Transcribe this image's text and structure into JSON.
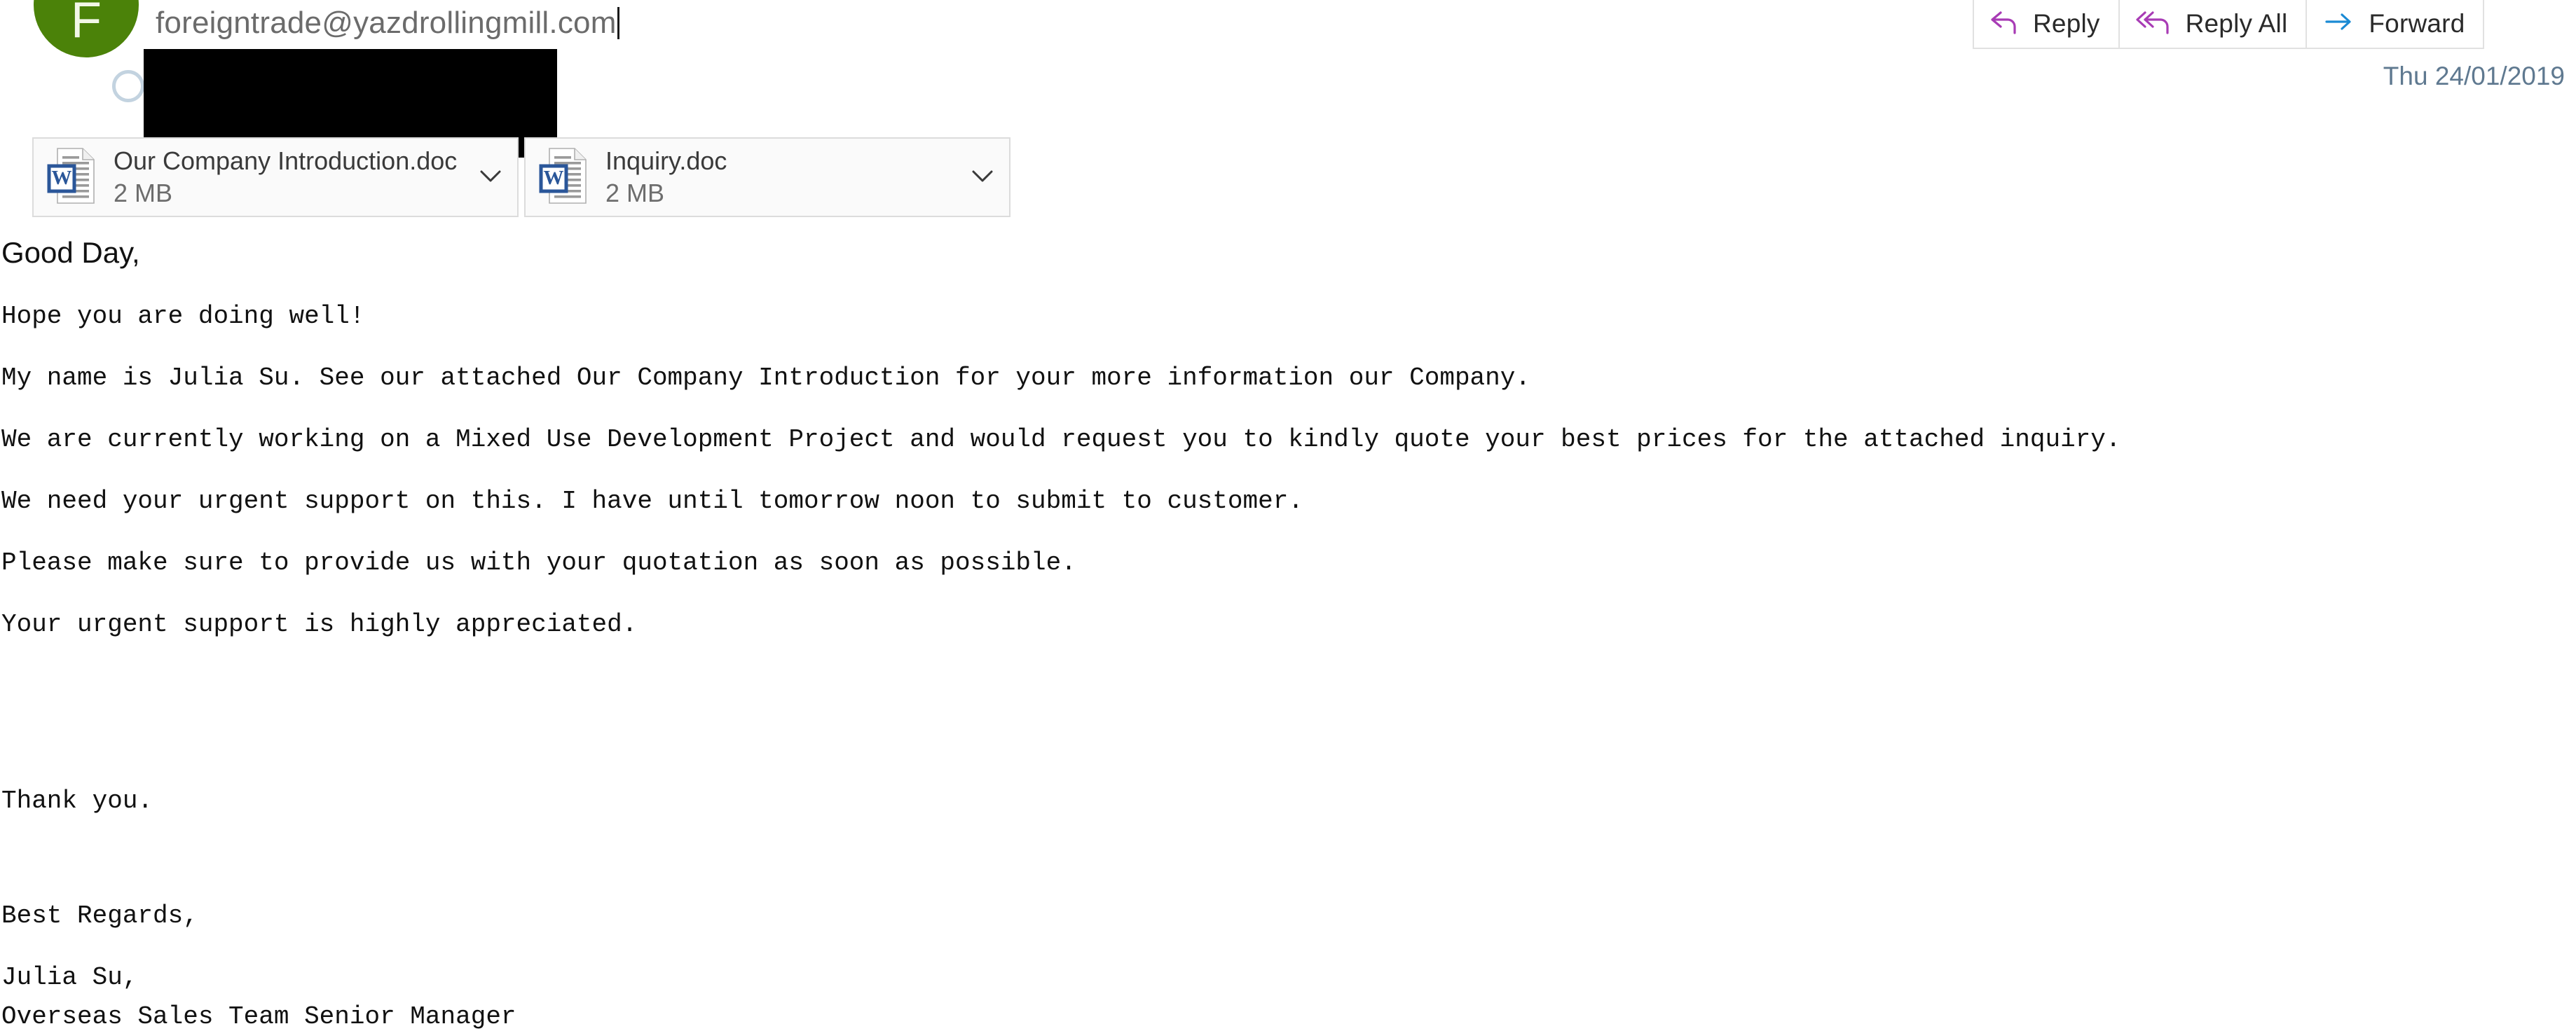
{
  "toolbar": {
    "buttons": [
      {
        "label": "Reply",
        "icon": "reply-arrow-icon",
        "color": "#a83bb5"
      },
      {
        "label": "Reply All",
        "icon": "reply-all-arrow-icon",
        "color": "#a83bb5"
      },
      {
        "label": "Forward",
        "icon": "forward-arrow-icon",
        "color": "#1a8ad4"
      }
    ]
  },
  "header": {
    "avatar_initial": "F",
    "avatar_color": "#4b8209",
    "sender_email": "foreigntrade@yazdrollingmill.com",
    "date": "Thu 24/01/2019",
    "presence_status": "offline"
  },
  "attachments": [
    {
      "name": "Our Company Introduction.doc",
      "size": "2 MB",
      "icon": "word-document-icon"
    },
    {
      "name": "Inquiry.doc",
      "size": "2 MB",
      "icon": "word-document-icon"
    }
  ],
  "message": {
    "greeting": "Good Day,",
    "paragraphs": [
      "Hope you are doing well!",
      "My name is Julia Su. See our attached Our Company Introduction for your more information our Company.",
      "We are currently working on a Mixed Use Development Project and would request you to kindly quote your best prices for the attached inquiry.",
      "We need your urgent support on this. I have until tomorrow noon to submit to customer.",
      "Please make sure to provide us with your quotation as soon as possible.",
      "Your urgent support is highly appreciated."
    ],
    "closing": "Thank you.",
    "regards": "Best Regards,",
    "signature_name": "Julia Su,",
    "signature_title": "Overseas Sales Team Senior Manager"
  }
}
